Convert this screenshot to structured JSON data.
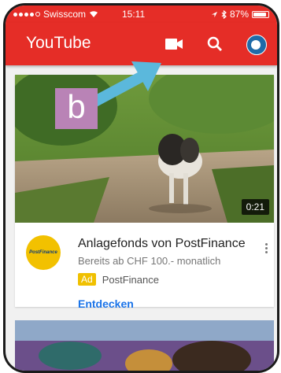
{
  "status_bar": {
    "carrier": "Swisscom",
    "time": "15:11",
    "battery": "87%",
    "battery_level": 0.87
  },
  "app_bar": {
    "title": "YouTube",
    "icons": [
      "camera-icon",
      "search-icon",
      "account-avatar"
    ]
  },
  "annotation": {
    "label": "b",
    "arrow_color": "#5bb8dc",
    "label_color": "#b983b6"
  },
  "video_card": {
    "duration": "0:21",
    "title": "Anlagefonds von PostFinance",
    "subtitle": "Bereits ab CHF 100.- monatlich",
    "ad_badge": "Ad",
    "advertiser": "PostFinance",
    "cta": "Entdecken",
    "logo_text": "PostFinance"
  },
  "colors": {
    "brand_red": "#e52d27",
    "ad_yellow": "#f0c000",
    "link_blue": "#1a73e8"
  }
}
